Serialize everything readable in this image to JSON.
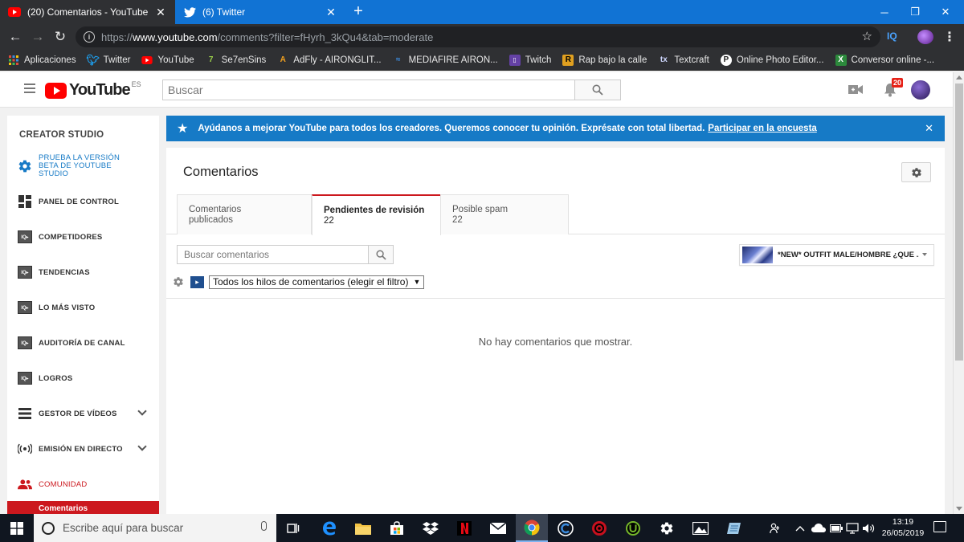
{
  "browser": {
    "tabs": [
      {
        "title": "(20) Comentarios - YouTube",
        "active": true
      },
      {
        "title": "(6) Twitter",
        "active": false
      }
    ],
    "new_tab_label": "+",
    "url_prefix": "https://",
    "url_domain": "www.youtube.com",
    "url_path": "/comments?filter=fHyrh_3kQu4&tab=moderate",
    "extension_label": "IQ",
    "bookmarks": [
      {
        "label": "Aplicaciones",
        "icon": "apps-grid-icon"
      },
      {
        "label": "Twitter",
        "icon": "twitter-icon"
      },
      {
        "label": "YouTube",
        "icon": "youtube-icon"
      },
      {
        "label": "Se7enSins",
        "icon": "se7ensins-icon"
      },
      {
        "label": "AdFly - AIRONGLIT...",
        "icon": "adfly-icon"
      },
      {
        "label": "MEDIAFIRE AIRON...",
        "icon": "mediafire-icon"
      },
      {
        "label": "Twitch",
        "icon": "twitch-icon"
      },
      {
        "label": "Rap bajo la calle",
        "icon": "rap-icon"
      },
      {
        "label": "Textcraft",
        "icon": "textcraft-icon"
      },
      {
        "label": "Online Photo Editor...",
        "icon": "photo-editor-icon"
      },
      {
        "label": "Conversor online -...",
        "icon": "converter-icon"
      }
    ]
  },
  "youtube": {
    "logo_text": "YouTube",
    "region": "ES",
    "search_placeholder": "Buscar",
    "notification_count": "20"
  },
  "sidebar": {
    "title": "CREATOR STUDIO",
    "items": [
      {
        "label": "PRUEBA LA VERSIÓN BETA DE YOUTUBE STUDIO",
        "icon": "gear-icon"
      },
      {
        "label": "PANEL DE CONTROL",
        "icon": "dashboard-icon"
      },
      {
        "label": "COMPETIDORES",
        "icon": "vidiq-icon"
      },
      {
        "label": "TENDENCIAS",
        "icon": "vidiq-icon"
      },
      {
        "label": "LO MÁS VISTO",
        "icon": "vidiq-icon"
      },
      {
        "label": "AUDITORÍA DE CANAL",
        "icon": "vidiq-icon"
      },
      {
        "label": "LOGROS",
        "icon": "vidiq-icon"
      },
      {
        "label": "GESTOR DE VÍDEOS",
        "icon": "video-manager-icon",
        "expandable": true
      },
      {
        "label": "EMISIÓN EN DIRECTO",
        "icon": "live-icon",
        "expandable": true
      },
      {
        "label": "COMUNIDAD",
        "icon": "community-icon"
      }
    ],
    "sub_item": "Comentarios"
  },
  "banner": {
    "text": "Ayúdanos a mejorar YouTube para todos los creadores. Queremos conocer tu opinión. Exprésate con total libertad.",
    "link": "Participar en la encuesta"
  },
  "comments": {
    "title": "Comentarios",
    "tabs": [
      {
        "label": "Comentarios publicados",
        "count": ""
      },
      {
        "label": "Pendientes de revisión",
        "count": "22"
      },
      {
        "label": "Posible spam",
        "count": "22"
      }
    ],
    "search_placeholder": "Buscar comentarios",
    "video_title": "*NEW* OUTFIT MALE/HOMBRE ¿QUE ...",
    "filter_value": "Todos los hilos de comentarios (elegir el filtro)",
    "empty_message": "No hay comentarios que mostrar."
  },
  "taskbar": {
    "search_placeholder": "Escribe aquí para buscar",
    "time": "13:19",
    "date": "26/05/2019"
  },
  "colors": {
    "chrome_tabbar": "#1173d4",
    "youtube_red": "#ff0000",
    "banner_blue": "#167ac6",
    "active_red": "#cc181e"
  }
}
